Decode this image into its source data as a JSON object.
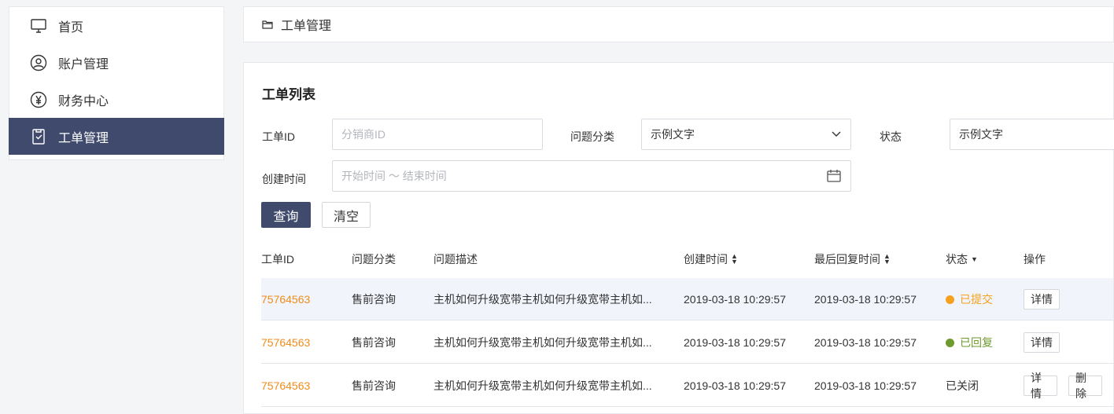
{
  "sidebar": {
    "items": [
      {
        "label": "首页",
        "icon": "monitor-icon"
      },
      {
        "label": "账户管理",
        "icon": "user-icon"
      },
      {
        "label": "财务中心",
        "icon": "yen-icon"
      },
      {
        "label": "工单管理",
        "icon": "clipboard-icon",
        "active": true
      }
    ]
  },
  "breadcrumb": {
    "label": "工单管理"
  },
  "panel": {
    "title": "工单列表"
  },
  "filters": {
    "id_label": "工单ID",
    "id_placeholder": "分销商ID",
    "category_label": "问题分类",
    "category_value": "示例文字",
    "status_label": "状态",
    "status_value": "示例文字",
    "date_label": "创建时间",
    "date_placeholder": "开始时间 ～ 结束时间",
    "query_button": "查询",
    "clear_button": "清空"
  },
  "table": {
    "headers": [
      "工单ID",
      "问题分类",
      "问题描述",
      "创建时间",
      "最后回复时间",
      "状态",
      "操作"
    ],
    "rows": [
      {
        "id": "75764563",
        "category": "售前咨询",
        "desc": "主机如何升级宽带主机如何升级宽带主机如...",
        "created": "2019-03-18 10:29:57",
        "replied": "2019-03-18 10:29:57",
        "status": "已提交",
        "status_color": "#f5a11c",
        "actions": [
          "详情"
        ]
      },
      {
        "id": "75764563",
        "category": "售前咨询",
        "desc": "主机如何升级宽带主机如何升级宽带主机如...",
        "created": "2019-03-18 10:29:57",
        "replied": "2019-03-18 10:29:57",
        "status": "已回复",
        "status_color": "#6e9a2e",
        "actions": [
          "详情"
        ]
      },
      {
        "id": "75764563",
        "category": "售前咨询",
        "desc": "主机如何升级宽带主机如何升级宽带主机如...",
        "created": "2019-03-18 10:29:57",
        "replied": "2019-03-18 10:29:57",
        "status": "已关闭",
        "status_color": "#333333",
        "actions": [
          "详情",
          "删除"
        ]
      }
    ]
  },
  "colors": {
    "accent": "#3f4a6c",
    "id": "#f08c1a"
  }
}
